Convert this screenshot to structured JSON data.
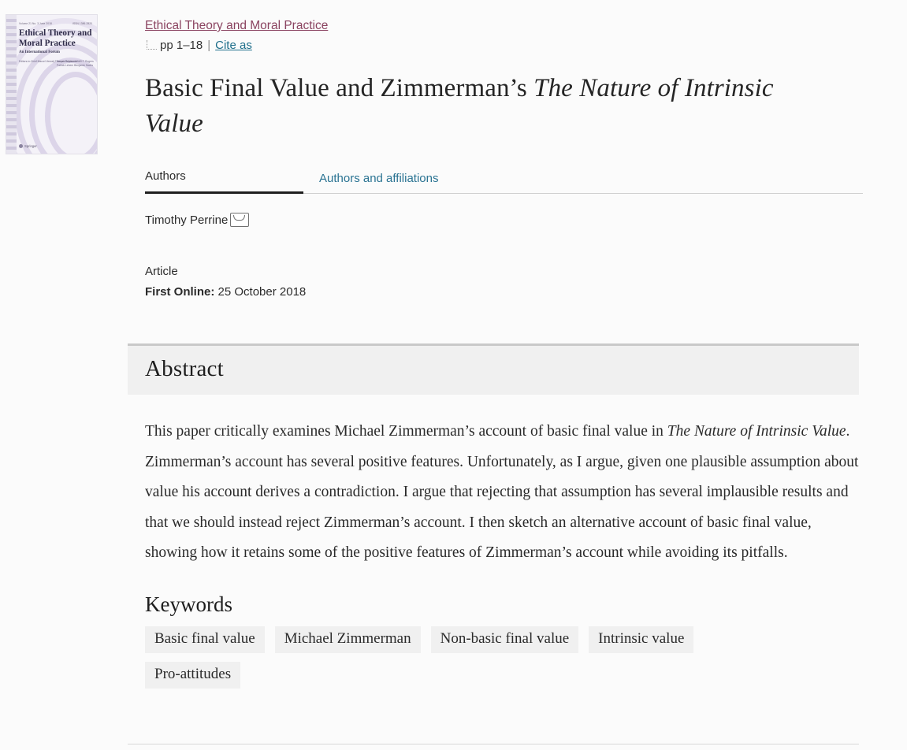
{
  "cover": {
    "issue_line_left": "Volume 21  No. 3  June 2018",
    "issue_line_right": "ISSN 1386-2820",
    "title": "Ethical Theory and Moral Practice",
    "subtitle": "An International Forum",
    "editors_left": "Editors-in-Chief\nMarcel Verweij\nThomas Schramme",
    "editors_right": "Deryck Beyleveld\nWill F. Rogers\nPatrick Lehern\nBenjamin Sachs",
    "publisher": "Springer"
  },
  "breadcrumb": {
    "journal_link": "Ethical Theory and Moral Practice",
    "pages": "pp 1–18",
    "separator": "|",
    "cite_as": "Cite as"
  },
  "title": {
    "part1": "Basic Final Value and Zimmerman’s ",
    "italic": "The Nature of Intrinsic Value"
  },
  "tabs": [
    {
      "label": "Authors",
      "active": true
    },
    {
      "label": "Authors and affiliations",
      "active": false
    }
  ],
  "authors": {
    "name": "Timothy Perrine",
    "contact_icon": "envelope-icon"
  },
  "meta": {
    "type": "Article",
    "first_online_label": "First Online:",
    "first_online_value": "25 October 2018"
  },
  "abstract": {
    "heading": "Abstract",
    "p1": "This paper critically examines Michael Zimmerman’s account of basic final value in ",
    "italic1": "The Nature of Intrinsic Value",
    "p2": ". Zimmerman’s account has several positive features. Unfortunately, as I argue, given one plausible assumption about value his account derives a contradiction. I argue that rejecting that assumption has several implausible results and that we should instead reject Zimmerman’s account. I then sketch an alternative account of basic final value, showing how it retains some of the positive features of Zimmerman’s account while avoiding its pitfalls."
  },
  "keywords": {
    "heading": "Keywords",
    "items": [
      "Basic final value",
      "Michael Zimmerman",
      "Non-basic final value",
      "Intrinsic value",
      "Pro-attitudes"
    ]
  },
  "colors": {
    "journal_link": "#8a4360",
    "cite_link": "#1f6f8b",
    "tab_link": "#2a7392",
    "band_bg": "#f0f0f0",
    "band_border": "#c9c9c9",
    "page_bg": "#fbfbfb"
  }
}
